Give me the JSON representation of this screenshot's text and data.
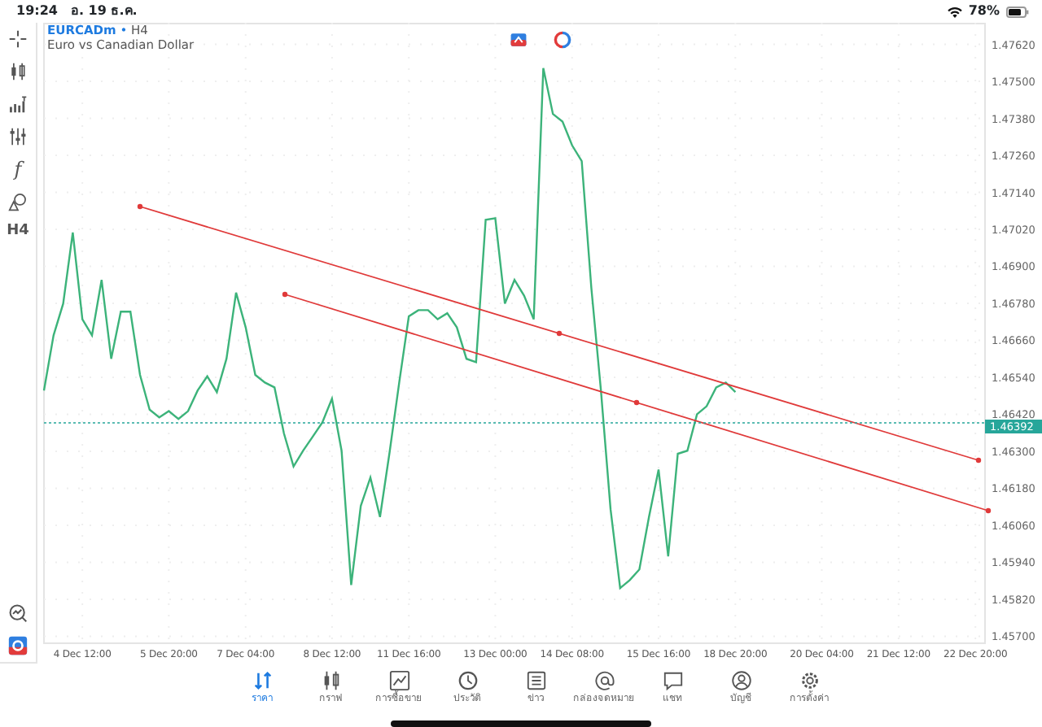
{
  "status_bar": {
    "time": "19:24",
    "date": "อ. 19 ธ.ค.",
    "battery": "78%"
  },
  "toolbar": [
    {
      "kind": "crosshair"
    },
    {
      "kind": "candles"
    },
    {
      "kind": "indicators"
    },
    {
      "kind": "sliders"
    },
    {
      "kind": "glyph",
      "text": "f"
    },
    {
      "kind": "shapes"
    },
    {
      "kind": "glyph",
      "text": "H4"
    }
  ],
  "toolbar_bottom": [
    {
      "kind": "chart-search"
    },
    {
      "kind": "logo"
    }
  ],
  "chart_header": {
    "separator": "•",
    "timeframe": "H4",
    "description": "Euro vs Canadian Dollar"
  },
  "chart_buttons": [
    {
      "kind": "trade"
    },
    {
      "kind": "signal"
    }
  ],
  "chart": {
    "current_price_line": {
      "kind": "dotted"
    },
    "trendlines": [
      {
        "kind": "trendline"
      },
      {
        "kind": "trendline"
      }
    ],
    "chart_data": {
      "type": "line",
      "grid": true,
      "categories": [
        null,
        null,
        null,
        null,
        "4 Dec 12:00",
        null,
        null,
        null,
        null,
        null,
        null,
        null,
        null,
        "5 Dec 20:00",
        null,
        null,
        null,
        null,
        null,
        null,
        null,
        "7 Dec 04:00",
        null,
        null,
        null,
        null,
        null,
        null,
        null,
        null,
        "8 Dec 12:00",
        null,
        null,
        null,
        null,
        null,
        null,
        null,
        "11 Dec 16:00",
        null,
        null,
        null,
        null,
        null,
        null,
        null,
        null,
        "13 Dec 00:00",
        null,
        null,
        null,
        null,
        null,
        null,
        null,
        "14 Dec 08:00",
        null,
        null,
        null,
        null,
        null,
        null,
        null,
        null,
        "15 Dec 16:00",
        null,
        null,
        null,
        null,
        null,
        null,
        null,
        "18 Dec 20:00",
        null,
        null,
        null,
        null,
        null,
        null,
        null,
        null,
        "20 Dec 04:00",
        null,
        null,
        null,
        null,
        null,
        null,
        null,
        "21 Dec 12:00",
        null,
        null,
        null,
        null,
        null,
        null,
        null,
        "22 Dec 20:00",
        null
      ],
      "series": [
        {
          "name": "EURCADm",
          "color": "#3cb37a",
          "values": [
            1.46497,
            1.46676,
            1.46779,
            1.4701,
            1.46728,
            1.46676,
            1.46856,
            1.466,
            1.46753,
            1.46753,
            1.46548,
            1.46435,
            1.4641,
            1.4643,
            1.46405,
            1.4643,
            1.46497,
            1.46543,
            1.46492,
            1.466,
            1.46815,
            1.46702,
            1.46548,
            1.46523,
            1.46507,
            1.46358,
            1.46251,
            1.46302,
            1.46348,
            1.46394,
            1.46471,
            1.46302,
            1.45866,
            1.46123,
            1.46215,
            1.46087,
            1.46297,
            1.46523,
            1.46738,
            1.46758,
            1.46758,
            1.46728,
            1.46748,
            1.46702,
            1.466,
            1.46589,
            1.47051,
            1.47056,
            1.46779,
            1.46856,
            1.46805,
            1.46728,
            1.47543,
            1.47394,
            1.47369,
            1.47292,
            1.47241,
            1.4683,
            1.46497,
            1.46112,
            1.45856,
            1.45882,
            1.45917,
            1.46087,
            1.46241,
            1.45959,
            1.46292,
            1.46302,
            1.4642,
            1.46446,
            1.46507,
            1.46523,
            1.46492,
            null,
            null,
            null,
            null,
            null,
            null,
            null,
            null,
            null,
            null,
            null,
            null,
            null,
            null,
            null,
            null,
            null,
            null,
            null,
            null,
            null,
            null,
            null,
            null,
            null,
            null
          ]
        }
      ],
      "ylim": [
        1.4568,
        1.4769
      ],
      "yticks": [
        {
          "value": 1.4762,
          "label": "1.47620"
        },
        {
          "value": 1.475,
          "label": "1.47500"
        },
        {
          "value": 1.4738,
          "label": "1.47380"
        },
        {
          "value": 1.4726,
          "label": "1.47260"
        },
        {
          "value": 1.4714,
          "label": "1.47140"
        },
        {
          "value": 1.4702,
          "label": "1.47020"
        },
        {
          "value": 1.469,
          "label": "1.46900"
        },
        {
          "value": 1.4678,
          "label": "1.46780"
        },
        {
          "value": 1.4666,
          "label": "1.46660"
        },
        {
          "value": 1.4654,
          "label": "1.46540"
        },
        {
          "value": 1.4642,
          "label": "1.46420"
        },
        {
          "value": 1.463,
          "label": "1.46300"
        },
        {
          "value": 1.4618,
          "label": "1.46180"
        },
        {
          "value": 1.4606,
          "label": "1.46060"
        },
        {
          "value": 1.4594,
          "label": "1.45940"
        },
        {
          "value": 1.4582,
          "label": "1.45820"
        },
        {
          "value": 1.457,
          "label": "1.45700"
        }
      ]
    },
    "current_price": {
      "label": "1.46392"
    }
  },
  "nav": [
    {
      "kind": "quotes",
      "label": "ราคา",
      "selected": true
    },
    {
      "kind": "candles",
      "label": "กราฟ",
      "selected": false
    },
    {
      "kind": "trade",
      "label": "การซื้อขาย",
      "selected": false
    },
    {
      "kind": "history",
      "label": "ประวัติ",
      "selected": false
    },
    {
      "kind": "news",
      "label": "ข่าว",
      "selected": false
    },
    {
      "kind": "mail",
      "label": "กล่องจดหมาย",
      "selected": false
    },
    {
      "kind": "chat",
      "label": "แชท",
      "selected": false
    },
    {
      "kind": "account",
      "label": "บัญชี",
      "selected": false
    },
    {
      "kind": "settings",
      "label": "การตั้งค่า",
      "selected": false
    }
  ]
}
